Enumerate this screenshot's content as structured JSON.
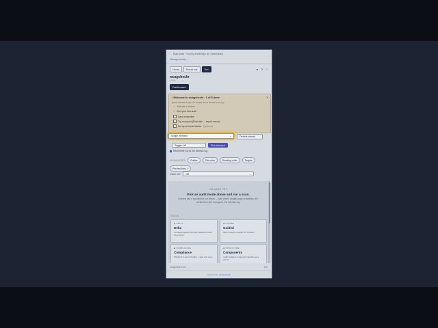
{
  "header": {
    "breadcrumb": "← Team plan · Survey archiving • AI • team plans",
    "manage_link": "Manage tooltip →"
  },
  "tabs": [
    {
      "label": "Home",
      "active": false
    },
    {
      "label": "Preset mix",
      "active": false
    },
    {
      "label": "Dev",
      "active": true
    }
  ],
  "toolbar_icons": [
    "square-icon",
    "gear-icon",
    "help-icon"
  ],
  "app": {
    "title": "wcagcheckr",
    "version": "v 0.21",
    "dashboard_button": "Dashboard"
  },
  "welcome": {
    "title": "• Welcome to wcagcheckr · 1 of 5 done",
    "subtitle": "Quick checklist to get you started. Items refresh as you go.",
    "items": [
      {
        "label": "Activate a license",
        "done": true
      },
      {
        "label": "Run your first audit",
        "done": false
      },
      {
        "label": "Save a baseline",
        "done": false
      },
      {
        "label": "Try an export (Extra tab → export menu)",
        "done": false
      },
      {
        "label": "Set up an issue tracker",
        "suffix": "(optional)",
        "done": false
      }
    ]
  },
  "mode": {
    "selected": "Single element",
    "subset_selected": "Default subset",
    "toggle_selected": "Toggle: off",
    "pick_button": "Pick element",
    "record_checkbox": "Record the run to the forensic log",
    "record_checked": true
  },
  "visualizers": {
    "label": "VISUALIZERS",
    "chips": [
      "Outline",
      "Tab order",
      "Reading order",
      "Targets",
      "Preview fixes ×"
    ]
  },
  "vision": {
    "label": "Vision sim",
    "selected": "Off"
  },
  "empty_state": {
    "kicker": "NO AUDIT YET",
    "heading": "Pick an audit mode above and run a scan.",
    "description": "Or jump into a specialized tool below — side sheet, weight, page schedules. 50+ sorted from, the in-to-good, the forensic log."
  },
  "tools": {
    "label": "TOOLS",
    "cards": [
      {
        "kicker": "◆ DELTA",
        "title": "Delta",
        "desc": "Compare against the last baseline match the prompt."
      },
      {
        "kicker": "◆ GUIDED",
        "title": "Guided",
        "desc": "Step through manual SC verifiers."
      },
      {
        "kicker": "◆ COMPLIANCE",
        "title": "Compliance",
        "desc": "WCAG 2.2 report builder + sign and save."
      },
      {
        "kicker": "◆ STRUCTURE",
        "title": "Components",
        "desc": "Audit isolated component families at a glance."
      }
    ]
  },
  "footer": {
    "left": "wcagcheckr.com",
    "right": "200",
    "powered_prefix": "Powered by",
    "powered_brand": "Lumenworks"
  }
}
